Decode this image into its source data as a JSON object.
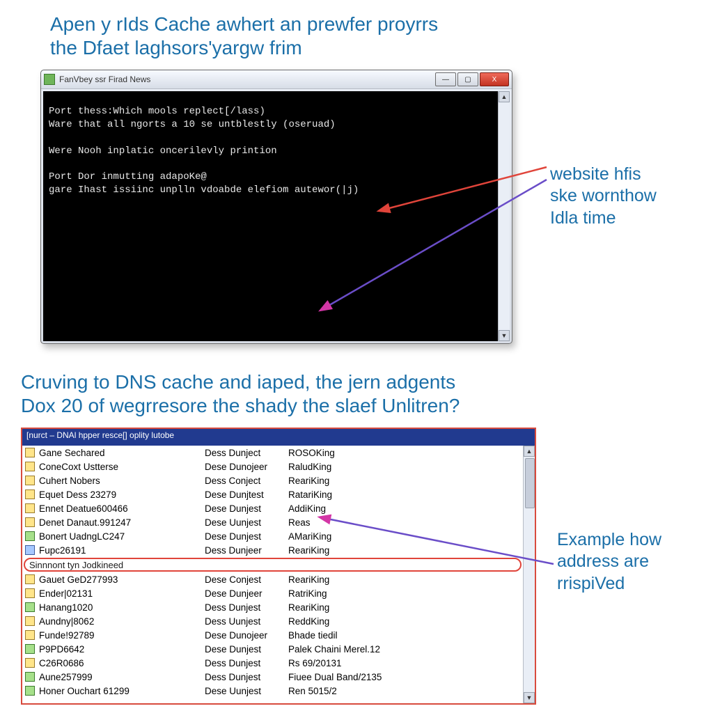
{
  "headings": {
    "h1_line1": "Apen y rIds Cache awhert an prewfer proyrrs",
    "h1_line2": "the Dfaet laghsors'yargw frim",
    "h2_line1": "Cruving to DNS cache and iaped, the jern adgents",
    "h2_line2": "Dox 20 of wegrresore the shady the slaef Unlitren?"
  },
  "annotations": {
    "top_line1": "website hfis",
    "top_line2": "ske wornthow",
    "top_line3": "Idla time",
    "bottom_line1": "Example how",
    "bottom_line2": "address are",
    "bottom_line3": "rrispiVed"
  },
  "console": {
    "title": "FanVbey ssr Firad News",
    "lines": [
      "Port thess:Which mools replect[/lass)",
      "Ware that all ngorts a 10 se untblestly (oseruad)",
      "",
      "Were Nooh inplatic oncerilevly printion",
      "",
      "Port Dor inmutting adapoKe@",
      "gare Ihast issiinc unplln vdoabde elefiom autewor(|j)"
    ],
    "buttons": {
      "min": "—",
      "max": "▢",
      "close": "X"
    }
  },
  "list": {
    "title": "[nurct – DNAl hpper resce[] oplity lutobe",
    "highlighted": "Sinnnont tyn Jodkineed",
    "groupA": [
      {
        "icon": "y",
        "c1": "Gane Sechared",
        "c2": "Dess Dunject",
        "c3": "ROSOKing"
      },
      {
        "icon": "y",
        "c1": "ConeCoxt Ustterse",
        "c2": "Dese Dunojeer",
        "c3": "RaludKing"
      },
      {
        "icon": "y",
        "c1": "Cuhert Nobers",
        "c2": "Dess Conject",
        "c3": "ReariKing"
      },
      {
        "icon": "y",
        "c1": "Equet Dess 23279",
        "c2": "Dese Dunjtest",
        "c3": "RatariKing"
      },
      {
        "icon": "y",
        "c1": "Ennet Deatue600466",
        "c2": "Dese Dunjest",
        "c3": "AddiKing"
      },
      {
        "icon": "y",
        "c1": "Denet Danaut.991247",
        "c2": "Dese Uunjest",
        "c3": "Reas"
      },
      {
        "icon": "g",
        "c1": "Bonert UadngLC247",
        "c2": "Dese Dunjest",
        "c3": "AMariKing"
      },
      {
        "icon": "b",
        "c1": "Fupc26191",
        "c2": "Dess Dunjeer",
        "c3": "ReariKing"
      }
    ],
    "groupB": [
      {
        "icon": "y",
        "c1": "Gauet GeD277993",
        "c2": "Dese Conjest",
        "c3": "ReariKing"
      },
      {
        "icon": "y",
        "c1": "Ender|02131",
        "c2": "Dese Dunjeer",
        "c3": "RatriKing"
      },
      {
        "icon": "g",
        "c1": "Hanang1020",
        "c2": "Dess Dunjest",
        "c3": "ReariKing"
      },
      {
        "icon": "y",
        "c1": "Aundny|8062",
        "c2": "Dess Uunjest",
        "c3": "ReddKing"
      },
      {
        "icon": "y",
        "c1": "Funde!92789",
        "c2": "Dese Dunojeer",
        "c3": "Bhade tiedil"
      },
      {
        "icon": "g",
        "c1": "P9PD6642",
        "c2": "Dese Dunjest",
        "c3": "Palek Chaini Merel.12"
      },
      {
        "icon": "y",
        "c1": "C26R0686",
        "c2": "Dess Dunjest",
        "c3": "Rs 69/20131"
      },
      {
        "icon": "g",
        "c1": "Aune257999",
        "c2": "Dess Dunjest",
        "c3": "Fiuee Dual Band/2135"
      },
      {
        "icon": "g",
        "c1": "Honer Ouchart 61299",
        "c2": "Dese Uunjest",
        "c3": "Ren 5015/2"
      }
    ]
  }
}
